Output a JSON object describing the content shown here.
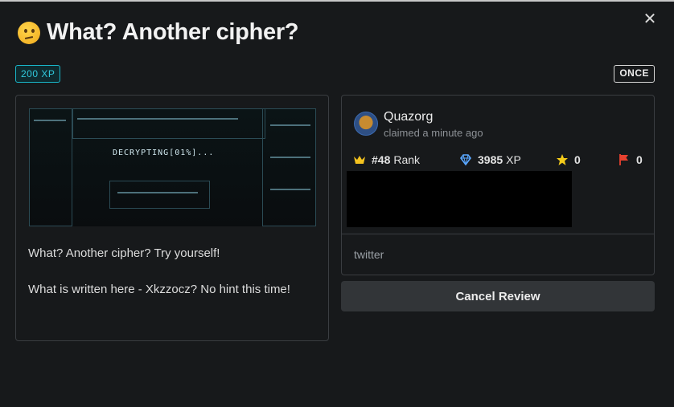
{
  "modal": {
    "title": "What? Another cipher?",
    "xp_badge": "200 XP",
    "frequency_badge": "ONCE"
  },
  "quest": {
    "hero_text": "DECRYPTING[01%]...",
    "description_line1": "What? Another cipher? Try yourself!",
    "description_line2": "What is written here - Xkzzocz? No hint this time!"
  },
  "claimer": {
    "username": "Quazorg",
    "claimed": "claimed a minute ago",
    "rank_value": "#48",
    "rank_label": "Rank",
    "xp_value": "3985",
    "xp_label": "XP",
    "stars": "0",
    "flags": "0",
    "tag": "twitter"
  },
  "actions": {
    "cancel_label": "Cancel Review"
  },
  "icons": {
    "close": "close-icon",
    "emoji": "thinking-face-icon",
    "rank": "crown-icon",
    "xp": "diamond-icon",
    "star": "star-icon",
    "flag": "flag-icon"
  },
  "colors": {
    "xp_accent": "#31c8db",
    "crown": "#f4c21f",
    "diamond": "#5aa7ff",
    "star": "#f5cc1a",
    "flag": "#e8412f"
  }
}
